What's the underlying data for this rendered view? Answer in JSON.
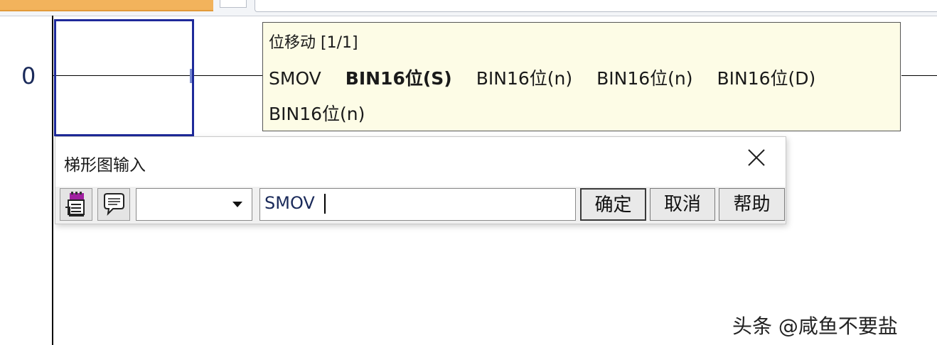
{
  "ladder": {
    "rung_number": "0"
  },
  "tooltip": {
    "title": "位移动 [1/1]",
    "instruction": "SMOV",
    "params": [
      "BIN16位(S)",
      "BIN16位(n)",
      "BIN16位(n)",
      "BIN16位(D)",
      "BIN16位(n)"
    ]
  },
  "dialog": {
    "title": "梯形图输入",
    "close_icon": "close-icon",
    "combo_value": "",
    "input_value": "SMOV ",
    "buttons": {
      "ok": "确定",
      "cancel": "取消",
      "help": "帮助"
    },
    "icons": [
      "instruction-list-icon",
      "comment-bubble-icon",
      "chevron-down-icon"
    ]
  },
  "watermark": "头条 @咸鱼不要盐",
  "colors": {
    "cursor_border": "#1e2a9a",
    "tooltip_bg": "#fdfce6",
    "tab_accent": "#f2b35c"
  }
}
